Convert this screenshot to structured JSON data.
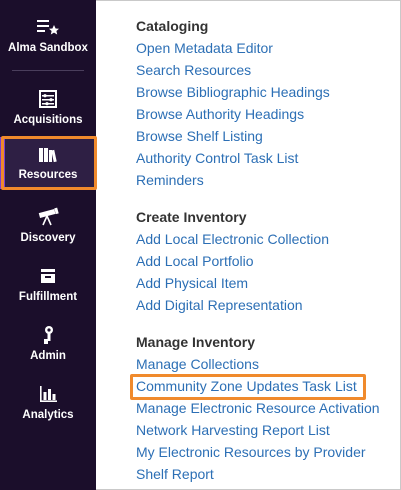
{
  "sidebar": {
    "items": [
      {
        "label": "Alma Sandbox",
        "icon": "menu-star-icon"
      },
      {
        "label": "Acquisitions",
        "icon": "abacus-icon"
      },
      {
        "label": "Resources",
        "icon": "books-icon",
        "active": true
      },
      {
        "label": "Discovery",
        "icon": "telescope-icon"
      },
      {
        "label": "Fulfillment",
        "icon": "inbox-tray-icon"
      },
      {
        "label": "Admin",
        "icon": "wrench-person-icon"
      },
      {
        "label": "Analytics",
        "icon": "bar-chart-icon"
      }
    ]
  },
  "menu": {
    "sections": [
      {
        "heading": "Cataloging",
        "links": [
          "Open Metadata Editor",
          "Search Resources",
          "Browse Bibliographic Headings",
          "Browse Authority Headings",
          "Browse Shelf Listing",
          "Authority Control Task List",
          "Reminders"
        ]
      },
      {
        "heading": "Create Inventory",
        "links": [
          "Add Local Electronic Collection",
          "Add Local Portfolio",
          "Add Physical Item",
          "Add Digital Representation"
        ]
      },
      {
        "heading": "Manage Inventory",
        "links": [
          "Manage Collections",
          "Community Zone Updates Task List",
          "Manage Electronic Resource Activation",
          "Network Harvesting Report List",
          "My Electronic Resources by Provider",
          "Shelf Report"
        ]
      }
    ]
  },
  "colors": {
    "sidebar_bg": "#1b0e2b",
    "link": "#2c6fb5",
    "heading": "#333333",
    "highlight": "#f08a2c",
    "active_accent": "#7a3fd1"
  }
}
